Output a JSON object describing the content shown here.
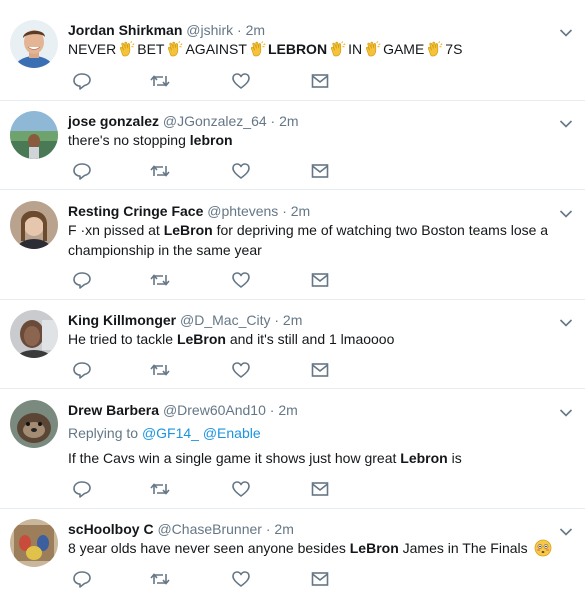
{
  "tweets": [
    {
      "name": "Jordan Shirkman",
      "handle": "@jshirk",
      "sep": "·",
      "time": "2m",
      "segments": [
        "NEVER",
        "BET",
        "AGAINST",
        "LEBRON",
        "IN",
        "GAME",
        "7S"
      ]
    },
    {
      "name": "jose gonzalez",
      "handle": "@JGonzalez_64",
      "sep": "·",
      "time": "2m",
      "text_before": "there's no stopping ",
      "text_bold": "lebron",
      "text_after": ""
    },
    {
      "name": "Resting Cringe Face",
      "handle": "@phtevens",
      "sep": "·",
      "time": "2m",
      "text_before": "F  ·xn pissed at ",
      "text_bold": "LeBron",
      "text_after": " for depriving me of watching two Boston teams lose a championship in the same year"
    },
    {
      "name": "King Killmonger",
      "handle": "@D_Mac_City",
      "sep": "·",
      "time": "2m",
      "text_before": "He tried to tackle ",
      "text_bold": "LeBron",
      "text_after": " and it's still and 1 lmaoooo"
    },
    {
      "name": "Drew Barbera",
      "handle": "@Drew60And10",
      "sep": "·",
      "time": "2m",
      "replying_label": "Replying to",
      "reply_1": "@GF14_",
      "reply_2": "@Enable",
      "text_before": "If the Cavs win a single game it shows just how great ",
      "text_bold": "Lebron",
      "text_after": " is"
    },
    {
      "name": "scHoolboy C",
      "handle": "@ChaseBrunner",
      "sep": "·",
      "time": "2m",
      "text_before": "8 year olds have never seen anyone besides ",
      "text_bold": "LeBron",
      "text_after": " James in The Finals"
    }
  ],
  "icons": {
    "reply": "reply-icon",
    "retweet": "retweet-icon",
    "like": "heart-icon",
    "message": "envelope-icon",
    "clap": "clapping-hands-emoji",
    "flushed": "flushed-face-emoji",
    "menu": "chevron-down-icon"
  },
  "colors": {
    "name": "#14171a",
    "meta": "#657786",
    "link": "#1b95e0",
    "divider": "#e6ecf0",
    "icon": "#657786"
  }
}
